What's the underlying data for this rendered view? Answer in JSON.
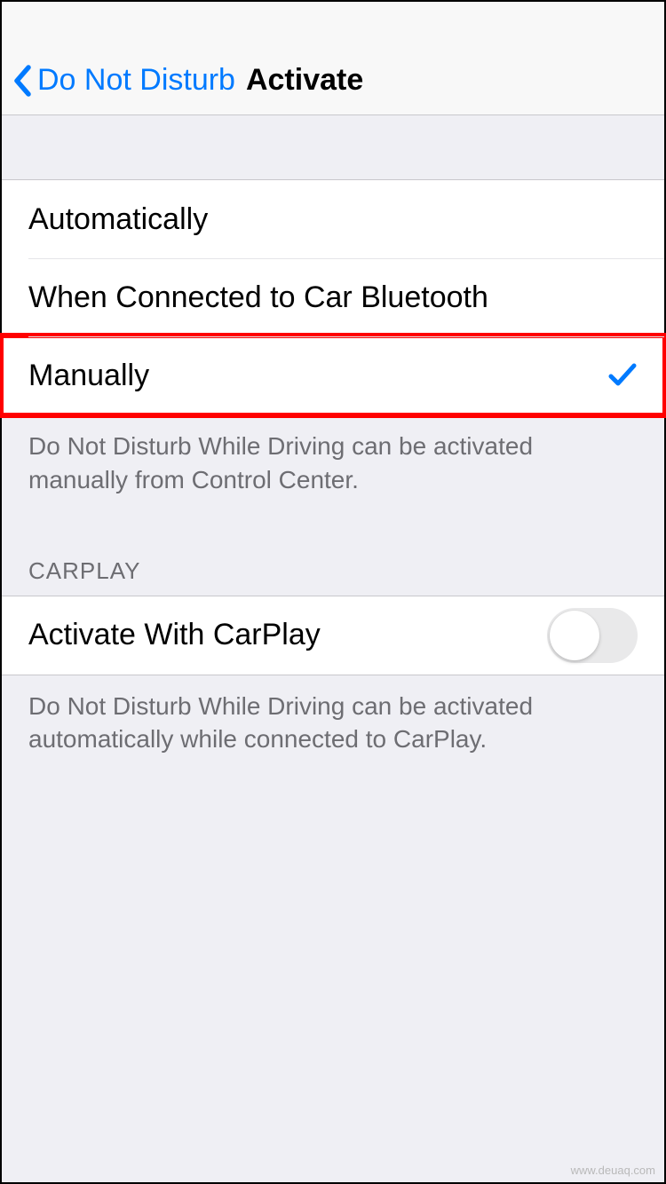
{
  "nav": {
    "back_label": "Do Not Disturb",
    "title": "Activate"
  },
  "options": {
    "automatically": "Automatically",
    "bluetooth": "When Connected to Car Bluetooth",
    "manually": "Manually",
    "selected": "manually",
    "footer": "Do Not Disturb While Driving can be activated manually from Control Center."
  },
  "carplay": {
    "header": "CARPLAY",
    "toggle_label": "Activate With CarPlay",
    "toggle_on": false,
    "footer": "Do Not Disturb While Driving can be activated automatically while connected to CarPlay."
  },
  "watermark": "www.deuaq.com"
}
